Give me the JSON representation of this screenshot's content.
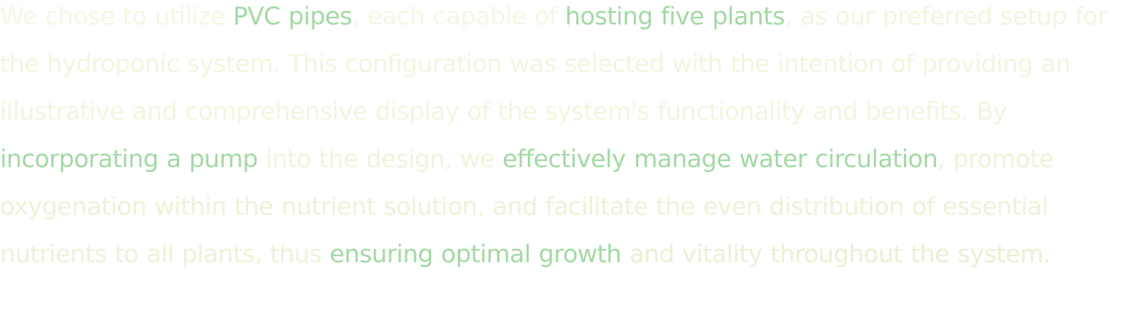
{
  "paragraph": {
    "segments": [
      {
        "text": "We chose to utilize ",
        "highlight": false
      },
      {
        "text": "PVC pipes",
        "highlight": true
      },
      {
        "text": ", each capable of ",
        "highlight": false
      },
      {
        "text": "hosting five plants",
        "highlight": true
      },
      {
        "text": ", as our preferred setup for the hydroponic system. This configuration was selected with the intention of providing an illustrative and comprehensive display of the system's functionality and benefits. By ",
        "highlight": false
      },
      {
        "text": "incorporating a pump",
        "highlight": true
      },
      {
        "text": " into the design, we ",
        "highlight": false
      },
      {
        "text": "effectively manage water circulation",
        "highlight": true
      },
      {
        "text": ", promote oxygenation within the nutrient solution, and facilitate the even distribution of essential nutrients to all plants, thus ",
        "highlight": false
      },
      {
        "text": "ensuring optimal growth",
        "highlight": true
      },
      {
        "text": " and vitality throughout the system.",
        "highlight": false
      }
    ]
  },
  "colors": {
    "plain_text": "#f2f6df",
    "highlight_text": "#a3d9a5",
    "background": "#ffffff"
  }
}
